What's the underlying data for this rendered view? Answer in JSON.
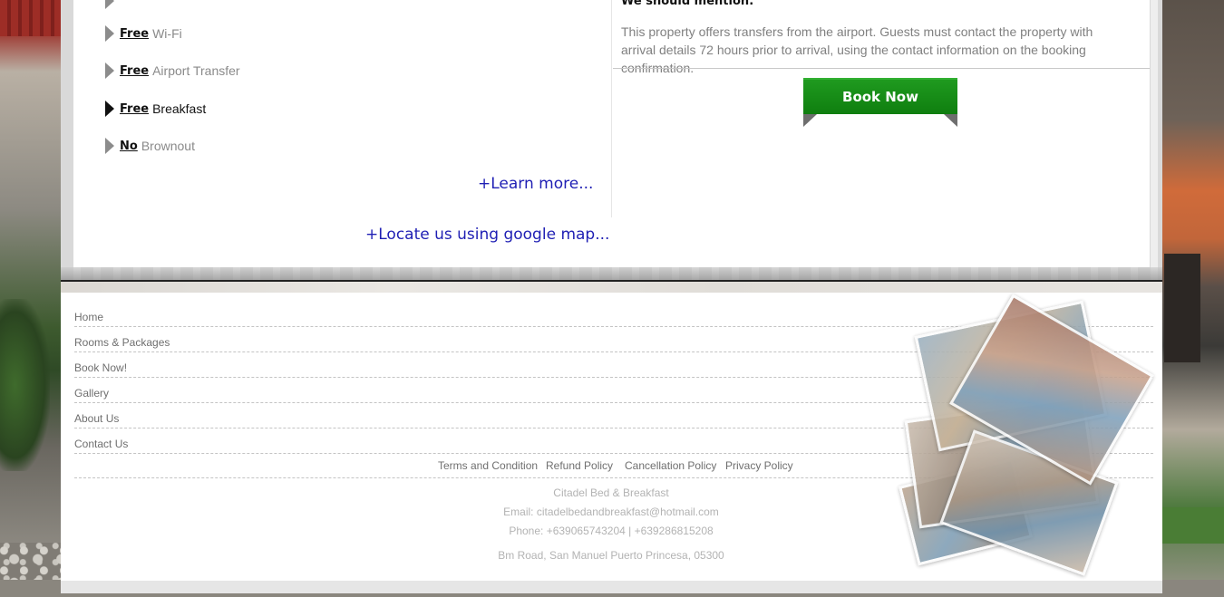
{
  "amenities": [
    {
      "keyword": "Free",
      "label": "Wi-Fi",
      "active": false
    },
    {
      "keyword": "Free",
      "label": "Airport Transfer",
      "active": false
    },
    {
      "keyword": "Free",
      "label": "Breakfast",
      "active": true
    },
    {
      "keyword": "No",
      "label": "Brownout",
      "active": false
    }
  ],
  "links": {
    "learn_more": "+Learn more...",
    "locate_map": "+Locate us using google map..."
  },
  "mention": {
    "title": "We should mention:",
    "text": "This property offers transfers from the airport. Guests must contact the property with arrival details 72 hours prior to arrival, using the contact information on the booking confirmation."
  },
  "book_button": {
    "label": "Book Now",
    "color": "#138a13"
  },
  "footer": {
    "nav": [
      "Home",
      "Rooms & Packages",
      "Book Now!",
      "Gallery",
      "About Us",
      "Contact Us"
    ],
    "policies": [
      "Terms and Condition",
      "Refund Policy",
      "Cancellation Policy",
      "Privacy Policy"
    ],
    "business_name": "Citadel Bed & Breakfast",
    "email": "Email: citadelbedandbreakfast@hotmail.com",
    "phone": "Phone: +639065743204 | +639286815208",
    "address": "Bm Road, San Manuel Puerto Princesa, 05300"
  },
  "colors": {
    "link": "#1f1fb4",
    "book_green": "#138a13",
    "text_gray": "#808080"
  },
  "icons": {
    "amenity_bullet": "triangle-right-icon"
  }
}
